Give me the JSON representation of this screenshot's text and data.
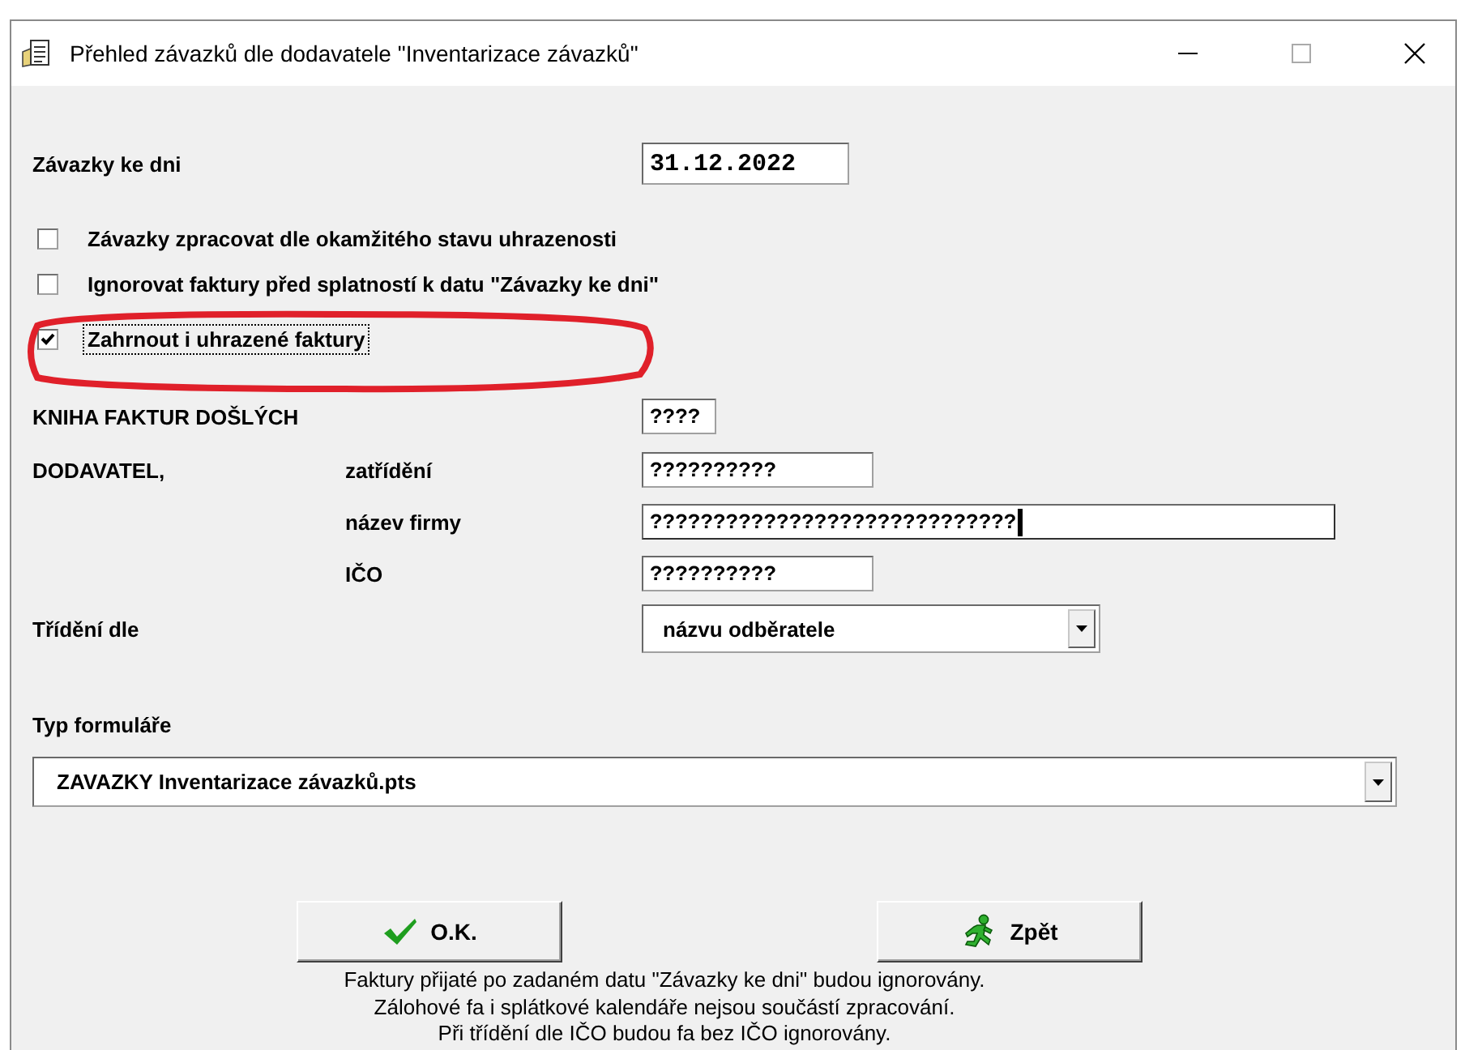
{
  "window": {
    "title": "Přehled závazků dle dodavatele \"Inventarizace závazků\""
  },
  "date_row": {
    "label": "Závazky ke dni",
    "value": "31.12.2022"
  },
  "checkboxes": [
    {
      "label": "Závazky zpracovat dle okamžitého stavu uhrazenosti",
      "checked": false,
      "focused": false
    },
    {
      "label": "Ignorovat faktury před splatností k datu \"Závazky ke dni\"",
      "checked": false,
      "focused": false
    },
    {
      "label": "Zahrnout i uhrazené faktury",
      "checked": true,
      "focused": true
    }
  ],
  "book": {
    "label": "KNIHA FAKTUR DOŠLÝCH",
    "value": "????"
  },
  "supplier": {
    "label": "DODAVATEL,",
    "fields": [
      {
        "label": "zatřídění",
        "value": "??????????",
        "wide": false,
        "focused": false
      },
      {
        "label": "název firmy",
        "value": "?????????????????????????????",
        "wide": true,
        "focused": true
      },
      {
        "label": "IČO",
        "value": "??????????",
        "wide": false,
        "focused": false
      }
    ]
  },
  "sort": {
    "label": "Třídění dle",
    "value": "názvu odběratele"
  },
  "form_type": {
    "label": "Typ formuláře",
    "value": "ZAVAZKY  Inventarizace závazků.pts"
  },
  "buttons": [
    {
      "kind": "ok",
      "label": "O.K."
    },
    {
      "kind": "back",
      "label": "Zpět"
    }
  ],
  "notes": [
    "Faktury přijaté po zadaném datu \"Závazky ke dni\" budou ignorovány.",
    "Zálohové fa i splátkové kalendáře nejsou součástí zpracování.",
    "Při třídění dle IČO budou fa bez IČO ignorovány."
  ]
}
